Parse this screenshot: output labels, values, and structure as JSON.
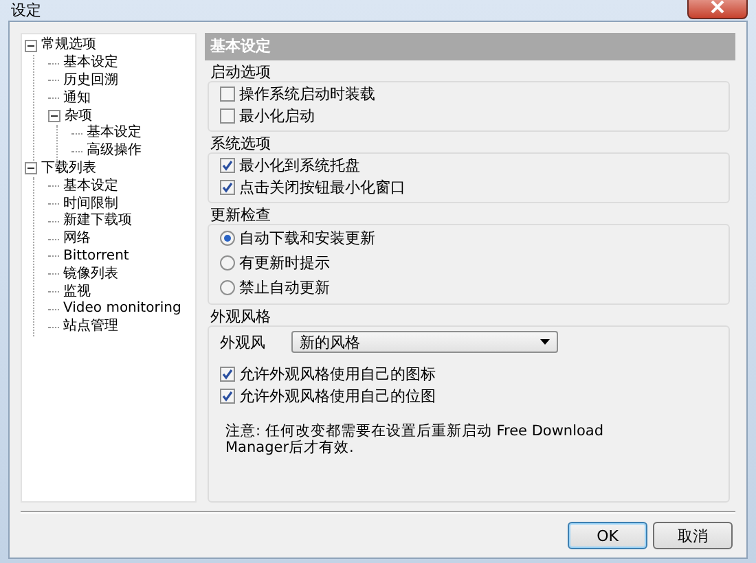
{
  "window": {
    "title": "设定"
  },
  "tree": [
    {
      "label": "常规选项",
      "expanded": true,
      "children": [
        {
          "label": "基本设定"
        },
        {
          "label": "历史回溯"
        },
        {
          "label": "通知"
        },
        {
          "label": "杂项",
          "expanded": true,
          "children": [
            {
              "label": "基本设定"
            },
            {
              "label": "高级操作"
            }
          ]
        }
      ]
    },
    {
      "label": "下载列表",
      "expanded": true,
      "children": [
        {
          "label": "基本设定"
        },
        {
          "label": "时间限制"
        },
        {
          "label": "新建下载项"
        },
        {
          "label": "网络"
        },
        {
          "label": "Bittorrent"
        },
        {
          "label": "镜像列表"
        },
        {
          "label": "监视"
        },
        {
          "label": "Video monitoring"
        },
        {
          "label": "站点管理"
        }
      ]
    }
  ],
  "panel": {
    "title": "基本设定",
    "groups": [
      {
        "title": "启动选项",
        "items": [
          {
            "kind": "checkbox",
            "label": "操作系统启动时装载",
            "checked": false
          },
          {
            "kind": "checkbox",
            "label": "最小化启动",
            "checked": false
          }
        ]
      },
      {
        "title": "系统选项",
        "items": [
          {
            "kind": "checkbox",
            "label": "最小化到系统托盘",
            "checked": true
          },
          {
            "kind": "checkbox",
            "label": "点击关闭按钮最小化窗口",
            "checked": true
          }
        ]
      },
      {
        "title": "更新检查",
        "items": [
          {
            "kind": "radio",
            "label": "自动下载和安装更新",
            "selected": true
          },
          {
            "kind": "radio",
            "label": "有更新时提示",
            "selected": false
          },
          {
            "kind": "radio",
            "label": "禁止自动更新",
            "selected": false
          }
        ]
      },
      {
        "title": "外观风格",
        "items": [
          {
            "kind": "dropdown",
            "label": "外观风",
            "value": "新的风格"
          },
          {
            "kind": "checkbox",
            "label": "允许外观风格使用自己的图标",
            "checked": true
          },
          {
            "kind": "checkbox",
            "label": "允许外观风格使用自己的位图",
            "checked": true
          },
          {
            "kind": "note",
            "label": "注意: 任何改变都需要在设置后重新启动 Free Download Manager后才有效."
          }
        ]
      }
    ]
  },
  "buttons": [
    "OK",
    "取消"
  ]
}
